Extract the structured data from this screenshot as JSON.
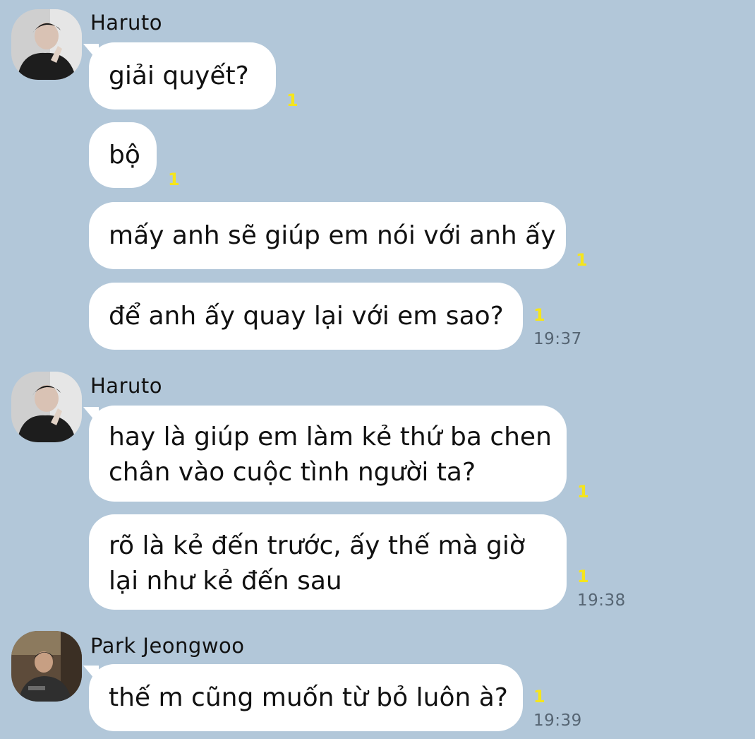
{
  "conversation": {
    "groups": [
      {
        "sender": "Haruto",
        "avatar_icon": "profile-photo-haruto",
        "messages": [
          {
            "lines": [
              "giải quyết?"
            ],
            "read_count": "1"
          },
          {
            "lines": [
              "bộ"
            ],
            "read_count": "1"
          },
          {
            "lines": [
              "mấy anh sẽ giúp em nói với anh ấy"
            ],
            "read_count": "1"
          },
          {
            "lines": [
              "để anh ấy quay lại với em sao?"
            ],
            "read_count": "1",
            "time": "19:37"
          }
        ]
      },
      {
        "sender": "Haruto",
        "avatar_icon": "profile-photo-haruto",
        "messages": [
          {
            "lines": [
              "hay là giúp em làm kẻ thứ ba chen",
              "chân vào cuộc tình người ta?"
            ],
            "read_count": "1"
          },
          {
            "lines": [
              "rõ là kẻ đến trước, ấy thế mà giờ",
              "lại như kẻ đến sau"
            ],
            "read_count": "1",
            "time": "19:38"
          }
        ]
      },
      {
        "sender": "Park Jeongwoo",
        "avatar_icon": "profile-photo-park-jeongwoo",
        "messages": [
          {
            "lines": [
              "thế m cũng muốn từ bỏ luôn à?"
            ],
            "read_count": "1",
            "time": "19:39"
          }
        ]
      }
    ]
  },
  "theme": {
    "background": "#b2c7d9",
    "bubble": "#ffffff",
    "read_count_color": "#f5e51c",
    "time_color": "#566573"
  }
}
